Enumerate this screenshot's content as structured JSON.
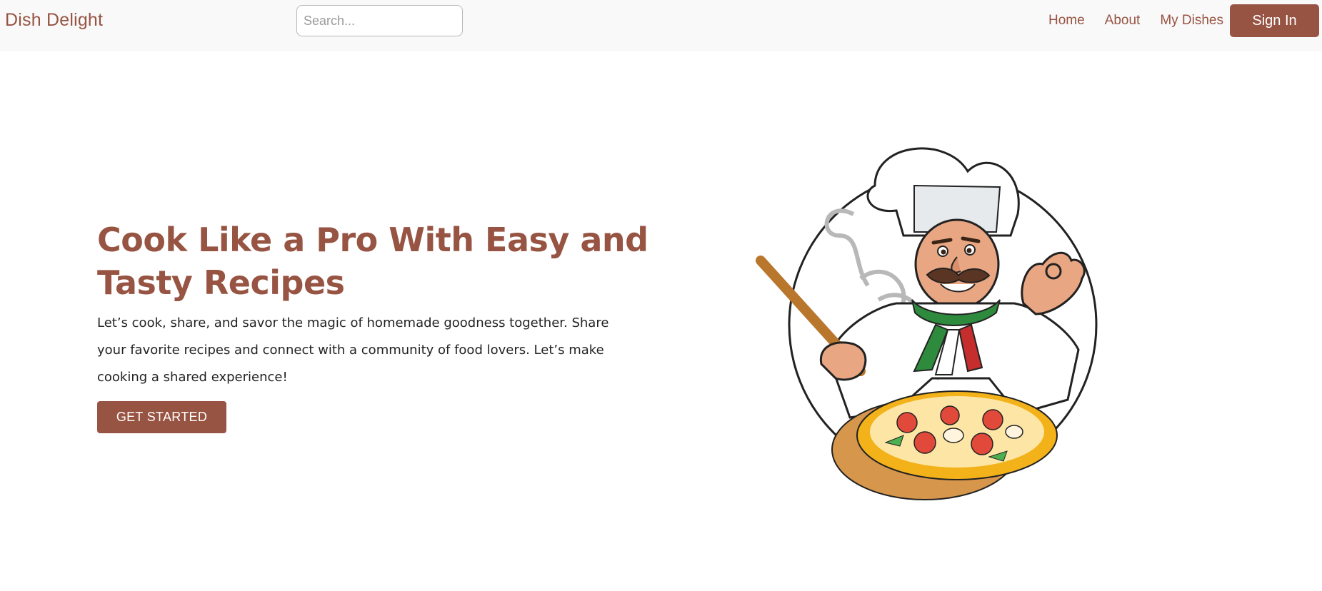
{
  "header": {
    "brand": "Dish Delight",
    "search": {
      "placeholder": "Search...",
      "value": ""
    },
    "nav": [
      {
        "label": "Home"
      },
      {
        "label": "About"
      },
      {
        "label": "My Dishes"
      }
    ],
    "sign_in_label": "Sign In"
  },
  "hero": {
    "title": "Cook Like a Pro With Easy and Tasty Recipes",
    "description": "Let’s cook, share, and savor the magic of homemade goodness together. Share your favorite recipes and connect with a community of food lovers. Let’s make cooking a shared experience!",
    "cta_label": "GET STARTED"
  },
  "illustration": {
    "subject": "chef-holding-pizza"
  },
  "colors": {
    "brand": "#975443",
    "navbar_bg": "#f9f9f9",
    "text": "#222222"
  }
}
